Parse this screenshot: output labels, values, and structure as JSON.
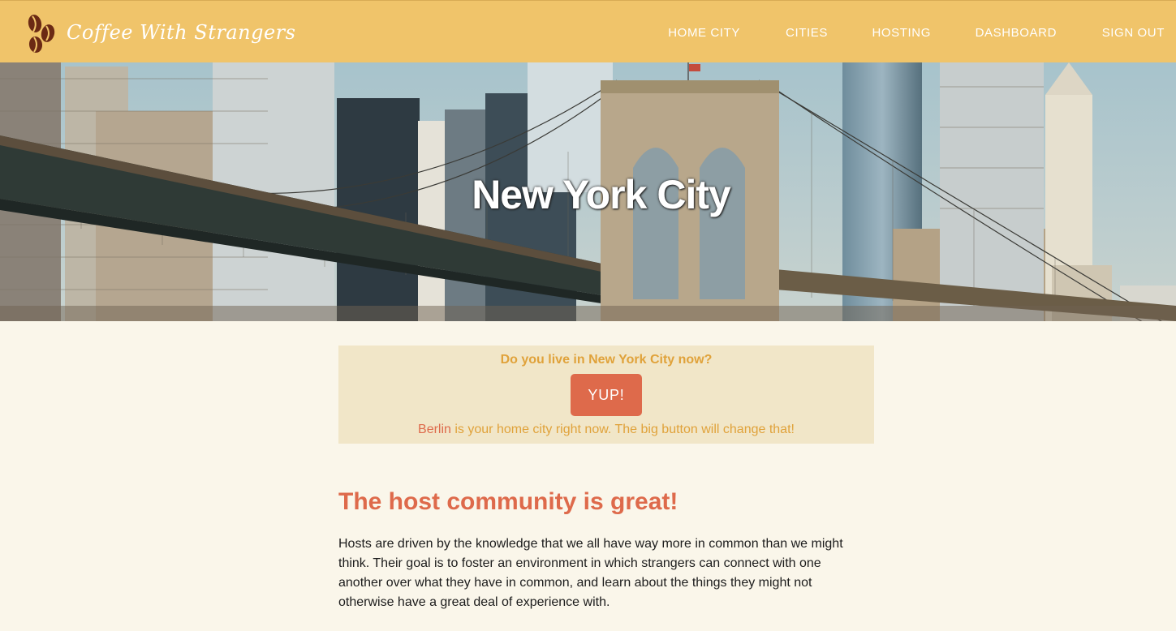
{
  "brand": {
    "name": "Coffee With Strangers"
  },
  "nav": {
    "items": [
      {
        "label": "HOME CITY"
      },
      {
        "label": "CITIES"
      },
      {
        "label": "HOSTING"
      },
      {
        "label": "DASHBOARD"
      },
      {
        "label": "SIGN OUT"
      }
    ]
  },
  "hero": {
    "title": "New York City"
  },
  "home_city_prompt": {
    "question": "Do you live in New York City now?",
    "button_label": "YUP!",
    "current_city": "Berlin",
    "note_suffix": " is your home city right now. The big button will change that!"
  },
  "content": {
    "heading": "The host community is great!",
    "body": "Hosts are driven by the knowledge that we all have way more in common than we might think. Their goal is to foster an environment in which strangers can connect with one another over what they have in common, and learn about the things they might not otherwise have a great deal of experience with."
  },
  "colors": {
    "header": "#f0c46a",
    "accent": "#de6a4b",
    "prompt_text": "#e0a23a",
    "prompt_bg": "#f1e6c8",
    "page_bg": "#faf6ea"
  },
  "icons": {
    "logo": "coffee-beans-icon"
  }
}
